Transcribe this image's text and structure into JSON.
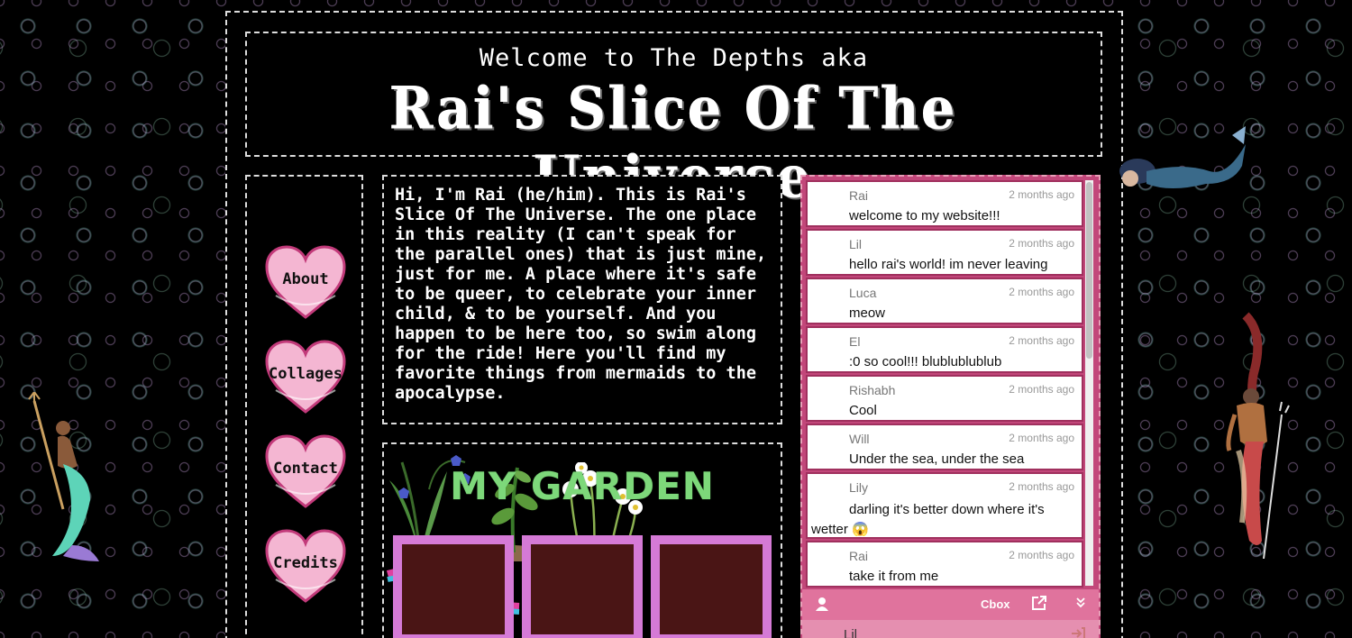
{
  "header": {
    "welcome": "Welcome to The Depths aka",
    "title": "Rai's Slice Of The Universe"
  },
  "nav": {
    "items": [
      {
        "label": "About"
      },
      {
        "label": "Collages"
      },
      {
        "label": "Contact"
      },
      {
        "label": "Credits"
      }
    ]
  },
  "intro": {
    "text": "Hi, I'm Rai (he/him). This is Rai's Slice Of The Universe. The one place in this reality (I can't speak for the parallel ones) that is just mine, just for me. A place where it's safe to be queer, to celebrate your inner child, & to be yourself. And you happen to be here too, so swim along for the ride! Here you'll find my favorite things from mermaids to the apocalypse."
  },
  "garden": {
    "title": "MY GARDEN"
  },
  "chat": {
    "messages": [
      {
        "name": "Rai",
        "time": "2 months ago",
        "text": "welcome to my website!!!"
      },
      {
        "name": "Lil",
        "time": "2 months ago",
        "text": "hello rai's world! im never leaving"
      },
      {
        "name": "Luca",
        "time": "2 months ago",
        "text": "meow"
      },
      {
        "name": "El",
        "time": "2 months ago",
        "text": ":0 so cool!!! blublublublub"
      },
      {
        "name": "Rishabh",
        "time": "2 months ago",
        "text": "Cool"
      },
      {
        "name": "Will",
        "time": "2 months ago",
        "text": "Under the sea, under the sea"
      },
      {
        "name": "Lily",
        "time": "2 months ago",
        "text": "darling it's better down where it's wetter 😱"
      },
      {
        "name": "Rai",
        "time": "2 months ago",
        "text": "take it from me"
      }
    ],
    "brand": "Cbox",
    "current_user": "Lil"
  },
  "colors": {
    "background": "#000000",
    "border": "#dddddd",
    "garden_title": "#7dd87a",
    "plot_frame": "#d57ad6",
    "soil": "#4a1515",
    "chat_frame": "#c2477a",
    "chat_bar": "#e0739d",
    "heart": "#f4b6d2"
  },
  "icons": [
    "user-icon",
    "external-link-icon",
    "chevron-double-down-icon",
    "sign-out-icon"
  ]
}
